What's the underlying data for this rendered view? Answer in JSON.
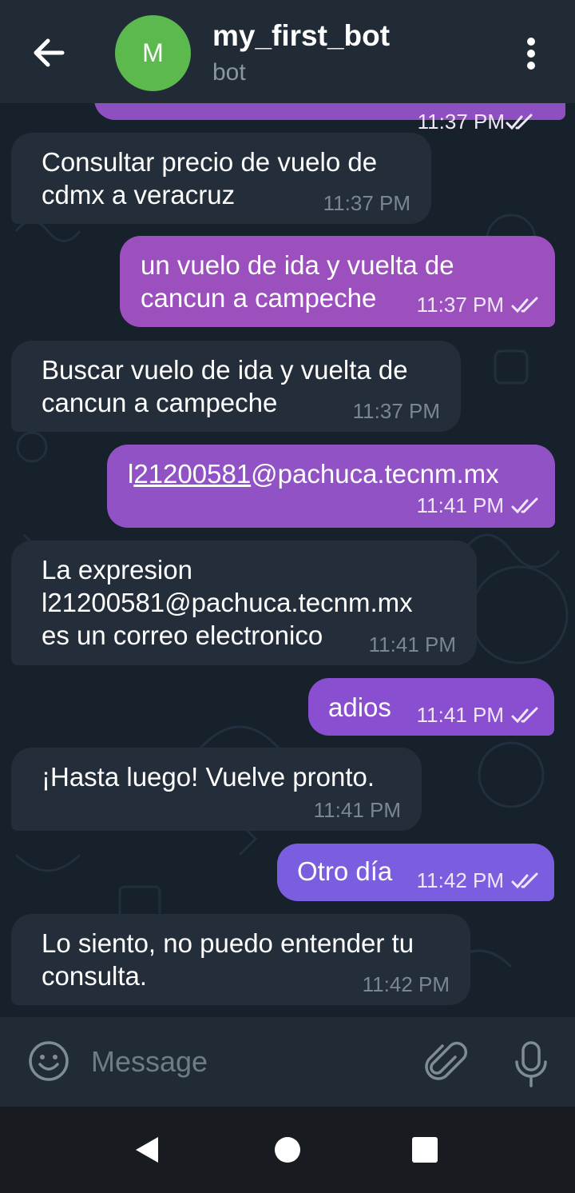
{
  "header": {
    "back_icon": "arrow-left-icon",
    "avatar_letter": "M",
    "avatar_color": "#5cb94e",
    "title": "my_first_bot",
    "subtitle": "bot",
    "menu_icon": "more-vertical-icon"
  },
  "messages": [
    {
      "direction": "out",
      "text": "",
      "time": "11:37 PM",
      "status_icon": "double-check-icon",
      "partially_visible": true
    },
    {
      "direction": "in",
      "text": "Consultar precio de vuelo de cdmx a veracruz",
      "time": "11:37 PM"
    },
    {
      "direction": "out",
      "text": "un vuelo de ida y vuelta de cancun a campeche",
      "time": "11:37 PM",
      "status_icon": "double-check-icon"
    },
    {
      "direction": "in",
      "text": "Buscar vuelo de ida y vuelta de cancun a campeche",
      "time": "11:37 PM"
    },
    {
      "direction": "out",
      "text_prefix": "l",
      "text_link": "21200581",
      "text_suffix": "@pachuca.tecnm.mx",
      "time": "11:41 PM",
      "status_icon": "double-check-icon"
    },
    {
      "direction": "in",
      "text_line1": "La expresion",
      "text_link": "l21200581@pachuca.tecnm.mx",
      "text_line3": "es un correo electronico",
      "time": "11:41 PM"
    },
    {
      "direction": "out",
      "text": "adios",
      "time": "11:41 PM",
      "status_icon": "double-check-icon"
    },
    {
      "direction": "in",
      "text": "¡Hasta luego! Vuelve pronto.",
      "time": "11:41 PM"
    },
    {
      "direction": "out",
      "text": "Otro día",
      "time": "11:42 PM",
      "status_icon": "double-check-icon"
    },
    {
      "direction": "in",
      "text": "Lo siento, no puedo entender tu consulta.",
      "time": "11:42 PM"
    }
  ],
  "colors": {
    "outgoing_bubble_start": "#8e4fc1",
    "outgoing_bubble_end": "#7b5ee0",
    "incoming_bubble": "#232e3a",
    "link": "#6ab2f2",
    "chat_background": "#17212b"
  },
  "composer": {
    "emoji_icon": "emoji-icon",
    "placeholder": "Message",
    "attach_icon": "paperclip-icon",
    "mic_icon": "microphone-icon"
  },
  "system_nav": {
    "back_icon": "triangle-back-icon",
    "home_icon": "circle-home-icon",
    "recents_icon": "square-recents-icon"
  }
}
